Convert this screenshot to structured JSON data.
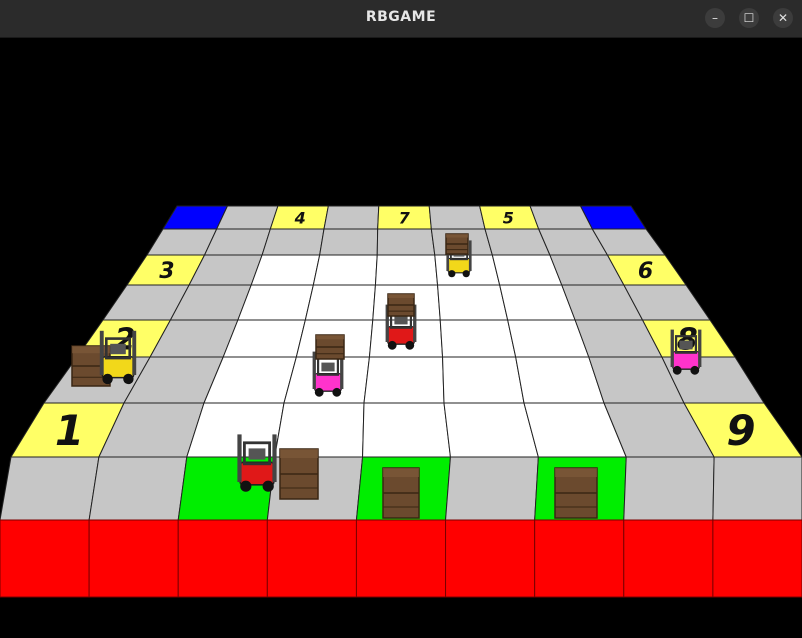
{
  "window": {
    "title": "RBGAME",
    "minimize_glyph": "–",
    "maximize_glyph": "☐",
    "close_glyph": "✕"
  },
  "colors": {
    "floor_inner": "#ffffff",
    "floor_border": "#c6c6c6",
    "station": "#ffff66",
    "corner": "#0000ff",
    "delivery": "#ff0000",
    "pickup": "#00ee00",
    "crate": "#6b4a2e"
  },
  "stations": {
    "s1": "1",
    "s2": "2",
    "s3": "3",
    "s4": "4",
    "s5": "5",
    "s6": "6",
    "s7": "7",
    "s8": "8",
    "s9": "9"
  },
  "robots": [
    {
      "name": "forklift-yellow-left",
      "color": "#f2d81a"
    },
    {
      "name": "forklift-pink-right",
      "color": "#ff33cc"
    },
    {
      "name": "forklift-red-bottom",
      "color": "#e01818"
    },
    {
      "name": "forklift-red-center",
      "color": "#e01818"
    },
    {
      "name": "forklift-pink-center",
      "color": "#ff33cc"
    },
    {
      "name": "forklift-yellow-top",
      "color": "#f2d81a"
    }
  ]
}
